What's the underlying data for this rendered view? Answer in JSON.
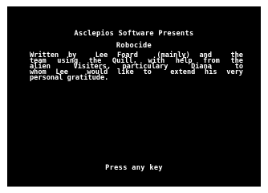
{
  "title": {
    "presenter": "Asclepios Software Presents",
    "game": "Robocide"
  },
  "credits": {
    "lines": [
      "Written by  Lee Foard  (mainly) and  the",
      "team using the Quill, with help from the",
      "alien  Visiters, particulary  Diana  to",
      "whom Lee  would like to  extend his very",
      "personal gratitude."
    ]
  },
  "prompt": "Press any key",
  "colors": {
    "border": "#ffffff",
    "paper": "#000000",
    "ink": "#ffffff"
  }
}
